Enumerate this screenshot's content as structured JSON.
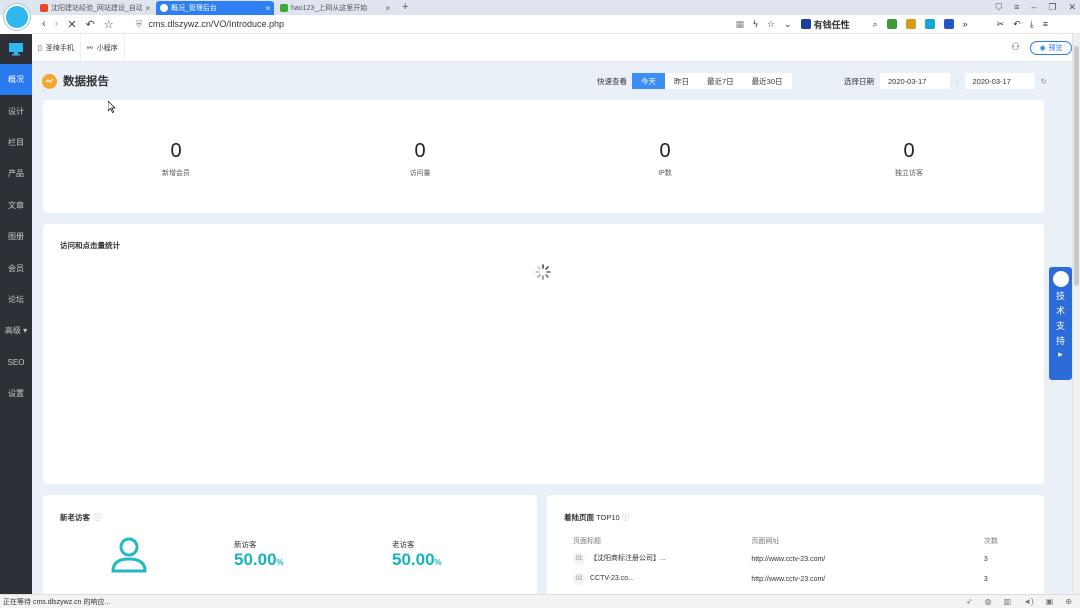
{
  "browser": {
    "tabs": [
      {
        "label": "沈阳建站经验_网站建设_自动…",
        "color": "#e8452c",
        "active": false
      },
      {
        "label": "概况_管理后台",
        "color": "#4ab3f0",
        "active": true
      },
      {
        "label": "hao123_上网从这里开始",
        "color": "#3ca83c",
        "active": false
      }
    ],
    "url": "cms.dlszywz.cn/VO/Introduce.php",
    "search_label": "有钱任性",
    "status_text": "正在等待 cms.dlszywz.cn 的响应..."
  },
  "subbar": {
    "mobile_label": "圣绮手机",
    "miniapp_label": "小程序",
    "preview_label": "预览"
  },
  "sidebar": {
    "items": [
      {
        "label": "概况",
        "active": true
      },
      {
        "label": "设计",
        "active": false
      },
      {
        "label": "栏目",
        "active": false
      },
      {
        "label": "产品",
        "active": false
      },
      {
        "label": "文章",
        "active": false
      },
      {
        "label": "图册",
        "active": false
      },
      {
        "label": "会员",
        "active": false
      },
      {
        "label": "论坛",
        "active": false
      },
      {
        "label": "高级 ▾",
        "active": false
      },
      {
        "label": "SEO",
        "active": false
      },
      {
        "label": "设置",
        "active": false
      }
    ]
  },
  "report": {
    "title": "数据报告",
    "quick_label": "快速查看",
    "quick_buttons": [
      "今天",
      "昨日",
      "最近7日",
      "最近30日"
    ],
    "date_label": "选择日期",
    "date_from": "2020-03-17",
    "date_sep": "-",
    "date_to": "2020-03-17"
  },
  "stats": [
    {
      "value": "0",
      "label": "新增会员"
    },
    {
      "value": "0",
      "label": "访问量"
    },
    {
      "value": "0",
      "label": "IP数"
    },
    {
      "value": "0",
      "label": "独立访客"
    }
  ],
  "chart_card": {
    "title": "访问和点击量统计"
  },
  "visitors": {
    "title": "新老访客",
    "new_label": "新访客",
    "new_value": "50.00",
    "old_label": "老访客",
    "old_value": "50.00",
    "unit": "%"
  },
  "landing": {
    "title": "着陆页面",
    "title_suffix": "TOP10",
    "headers": [
      "页面标题",
      "页面网址",
      "次数"
    ],
    "rows": [
      {
        "idx": "01",
        "title": "【沈阳商标注册公司】...",
        "url": "http://www.cctv-23.com/",
        "count": "3"
      },
      {
        "idx": "02",
        "title": "CCTV-23.co...",
        "url": "http://www.cctv-23.com/",
        "count": "3"
      }
    ]
  },
  "support": {
    "label": [
      "技",
      "术",
      "支",
      "持"
    ]
  }
}
